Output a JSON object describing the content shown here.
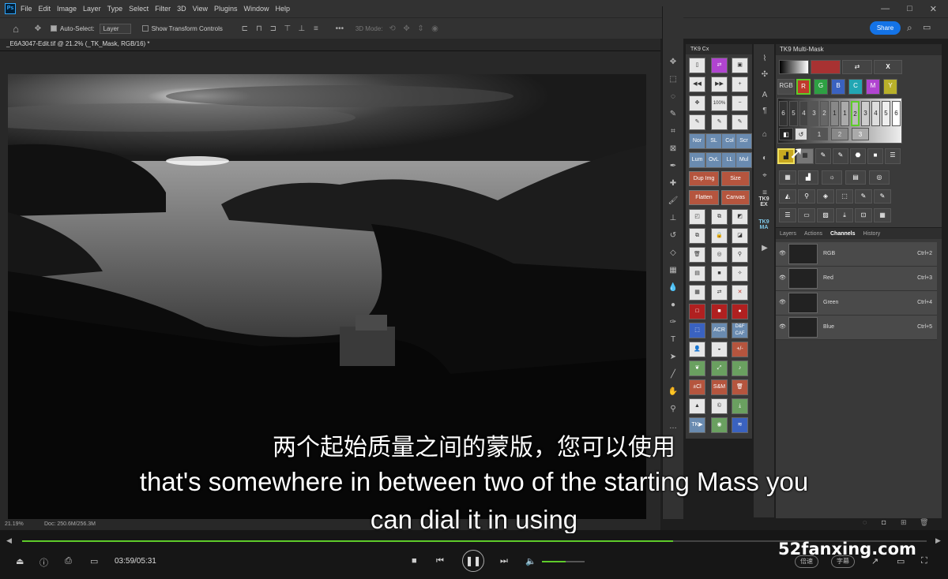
{
  "menubar": {
    "logo": "Ps",
    "items": [
      "File",
      "Edit",
      "Image",
      "Layer",
      "Type",
      "Select",
      "Filter",
      "3D",
      "View",
      "Plugins",
      "Window",
      "Help"
    ]
  },
  "options": {
    "auto_select": "Auto-Select:",
    "layer_dropdown": "Layer",
    "show_transform": "Show Transform Controls",
    "mode3d": "3D Mode:",
    "share": "Share"
  },
  "document": {
    "tab": "_E6A3047-Edit.tif @ 21.2% (_TK_Mask, RGB/16) *",
    "zoom": "21.19%",
    "doc_size": "Doc: 250.6M/256.3M"
  },
  "cx_panel": {
    "title": "TK9 Cx",
    "labels": [
      "100%",
      "Nor",
      "SL",
      "Col",
      "Scr",
      "Lum",
      "OvL",
      "LL",
      "Mul",
      "Dup Img",
      "Size",
      "Flatten",
      "Canvas",
      "ACR",
      "D&F CAF",
      "+/-",
      "±Cl",
      "S&M",
      "TK▶"
    ]
  },
  "strip": {
    "labels": [
      "TK9 EX",
      "TK9 MA"
    ]
  },
  "multimask": {
    "title": "TK9 Multi-Mask",
    "x_label": "X",
    "rgb": "RGB",
    "channels": [
      "R",
      "G",
      "B",
      "C",
      "M",
      "Y"
    ],
    "top_row": [
      "6",
      "5",
      "4",
      "3",
      "2",
      "1",
      "1",
      "2",
      "3",
      "4",
      "5",
      "6"
    ],
    "bottom_row": [
      "1",
      "2",
      "3"
    ]
  },
  "channels": {
    "tabs": [
      "Layers",
      "Actions",
      "Channels",
      "History"
    ],
    "active_tab": "Channels",
    "rows": [
      {
        "name": "RGB",
        "shortcut": "Ctrl+2"
      },
      {
        "name": "Red",
        "shortcut": "Ctrl+3"
      },
      {
        "name": "Green",
        "shortcut": "Ctrl+4"
      },
      {
        "name": "Blue",
        "shortcut": "Ctrl+5"
      }
    ]
  },
  "player": {
    "time": "03:59/05:31",
    "progress": 0.72,
    "volume": 0.55,
    "watermark": "52fanxing.com",
    "speed": "倍速",
    "subtitle_btn": "字幕"
  },
  "subtitles": {
    "cn": "两个起始质量之间的蒙版，您可以使用",
    "en1": "that's somewhere in between two of the starting Mass you",
    "en2": "can dial it in using"
  },
  "colors": {
    "accent": "#1473e6",
    "progress": "#5ecb2a"
  }
}
